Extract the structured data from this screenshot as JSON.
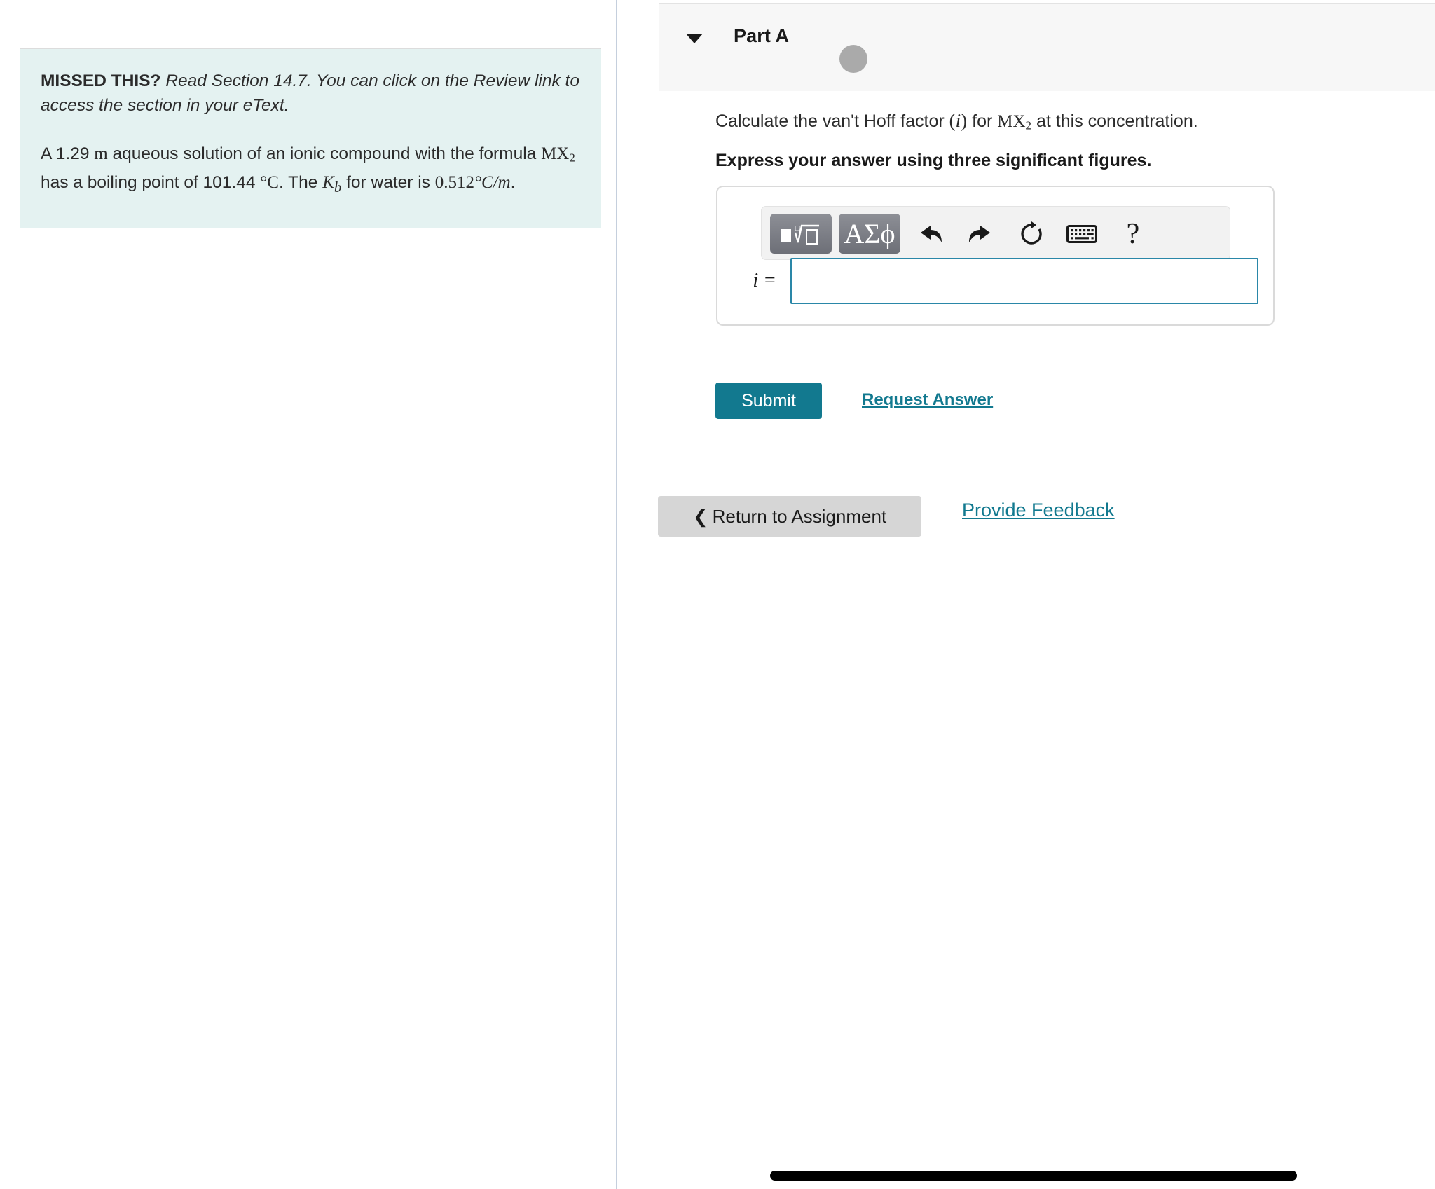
{
  "left_panel": {
    "hint": {
      "lead_label": "MISSED THIS?",
      "lead_italic": " Read Section 14.7. You can click on the Review link to access the section in your eText.",
      "problem_part1": "A 1.29 ",
      "problem_molal_unit": "m",
      "problem_part2": " aqueous solution of an ionic compound with the formula ",
      "problem_formula": "MX",
      "problem_formula_sub": "2",
      "problem_part3": " has a boiling point of 101.44 ",
      "problem_degC": "°C",
      "problem_part4": ". The ",
      "problem_kb": "K",
      "problem_kb_sub": "b",
      "problem_part5": " for water is ",
      "problem_kb_value": "0.512",
      "problem_kb_units": "°C/m",
      "problem_part6": "."
    }
  },
  "right_panel": {
    "part": {
      "title": "Part A",
      "collapse_icon": "chevron-down-icon",
      "status_icon": "status-dot"
    },
    "question": {
      "line_before_i": "Calculate the van't Hoff factor ",
      "i_symbol": "i",
      "line_after_i": " for ",
      "formula": "MX",
      "formula_sub": "2",
      "line_end": " at this concentration.",
      "instruction": "Express your answer using three significant figures."
    },
    "toolbar": {
      "template_button_icon": "math-template-icon",
      "greek_button_label": "ΑΣϕ",
      "undo_icon": "undo-arrow-icon",
      "redo_icon": "redo-arrow-icon",
      "reset_icon": "reset-circular-arrow-icon",
      "keyboard_icon": "keyboard-icon",
      "help_label": "?"
    },
    "answer": {
      "label": "i =",
      "value": "",
      "placeholder": ""
    },
    "actions": {
      "submit_label": "Submit",
      "request_answer_label": "Request Answer"
    },
    "footer": {
      "return_chevron": "❮",
      "return_label": "Return to Assignment",
      "feedback_label": "Provide Feedback"
    }
  },
  "colors": {
    "hint_background": "#e4f2f1",
    "accent_teal": "#12798f",
    "input_border": "#2a87a8",
    "part_header_background": "#f7f7f7",
    "return_button_background": "#d6d6d6",
    "status_dot": "#aaaaaa",
    "divider": "#c5cfdd"
  }
}
